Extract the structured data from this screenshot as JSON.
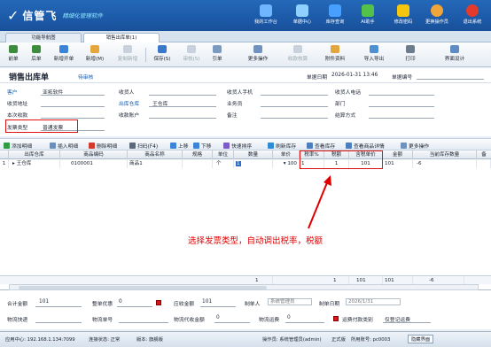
{
  "app": {
    "logo_text": "信管飞",
    "tagline": "精细化管理软件"
  },
  "top_nav": [
    {
      "label": "我的工作台",
      "icon": "monitor-icon"
    },
    {
      "label": "单据中心",
      "icon": "document-icon"
    },
    {
      "label": "库存查询",
      "icon": "warehouse-icon"
    },
    {
      "label": "AI助手",
      "icon": "ai-assistant-icon"
    },
    {
      "label": "修改密码",
      "icon": "lock-icon"
    },
    {
      "label": "更换操作员",
      "icon": "user-icon"
    },
    {
      "label": "退出系统",
      "icon": "exit-icon"
    }
  ],
  "tabs": [
    {
      "label": "功能导航图"
    },
    {
      "label": "销售出库单(1)"
    }
  ],
  "toolbar": [
    {
      "label": "前单",
      "icon": "arrow-left-icon"
    },
    {
      "label": "后单",
      "icon": "arrow-right-icon"
    },
    {
      "label": "新增开单",
      "icon": "new-icon"
    },
    {
      "label": "新增(M)",
      "icon": "add-icon"
    },
    {
      "label": "复制新增",
      "icon": "copy-icon"
    },
    {
      "label": "保存(S)",
      "icon": "save-icon"
    },
    {
      "label": "审核(S)",
      "icon": "audit-icon"
    },
    {
      "label": "引单",
      "icon": "import-order-icon"
    },
    {
      "label": "更多操作",
      "icon": "more-icon"
    },
    {
      "label": "收款核算",
      "icon": "payment-icon"
    },
    {
      "label": "附件资料",
      "icon": "attachment-icon"
    },
    {
      "label": "导入导出",
      "icon": "import-export-icon"
    },
    {
      "label": "打印",
      "icon": "print-icon"
    },
    {
      "label": "界面设计",
      "icon": "design-icon"
    }
  ],
  "doc": {
    "title": "销售出库单",
    "status": "待审核",
    "date_label": "单据日期",
    "date_value": "2026-01-31 13:46",
    "number_label": "单据编号",
    "number_value": ""
  },
  "form": {
    "customer_label": "客户",
    "customer_value": "亚拓软件",
    "shipper_label": "收货人",
    "shipper_value": "",
    "shipper_phone_label": "收货人手机",
    "shipper_phone_value": "",
    "contact_phone_label": "收货人电话",
    "contact_phone_value": "",
    "address_label": "收货地址",
    "address_value": "",
    "warehouse_label": "出库仓库",
    "warehouse_value": "王仓库",
    "salesman_label": "业务员",
    "salesman_value": "",
    "department_label": "部门",
    "department_value": "",
    "this_receipt_label": "本次收款",
    "this_receipt_value": "",
    "receipt_account_label": "收款账户",
    "receipt_account_value": "",
    "remark_label": "备注",
    "remark_value": "",
    "settlement_label": "结算方式",
    "settlement_value": "",
    "invoice_type_label": "发票类型",
    "invoice_type_value": "普通发票"
  },
  "grid_toolbar": [
    {
      "label": "添加明细",
      "icon": "add-row-icon"
    },
    {
      "label": "插入明细",
      "icon": "insert-row-icon"
    },
    {
      "label": "删除明细",
      "icon": "delete-row-icon"
    },
    {
      "label": "扫码(F4)",
      "icon": "scan-icon"
    },
    {
      "label": "上移",
      "icon": "move-up-icon"
    },
    {
      "label": "下移",
      "icon": "move-down-icon"
    },
    {
      "label": "快速排序",
      "icon": "sort-icon"
    },
    {
      "label": "刷新库存",
      "icon": "refresh-icon"
    },
    {
      "label": "查看库存",
      "icon": "view-stock-icon"
    },
    {
      "label": "查看商品详情",
      "icon": "product-detail-icon"
    },
    {
      "label": "更多操作",
      "icon": "more-ops-icon"
    }
  ],
  "grid": {
    "columns": [
      "",
      "出库仓库",
      "商品编码",
      "商品名称",
      "规格",
      "单位",
      "数量",
      "单价",
      "税率%",
      "税额",
      "含税单价",
      "金额",
      "当前库存数量",
      "备"
    ],
    "rows": [
      {
        "idx": "1",
        "warehouse": "王仓库",
        "code": "0100001",
        "name": "商品1",
        "spec": "",
        "unit": "个",
        "qty": "1",
        "price": "100",
        "tax_rate": "1",
        "tax": "1",
        "tax_price": "101",
        "amount": "101",
        "stock": "-6",
        "note": ""
      }
    ],
    "footer": {
      "qty": "1",
      "tax": "1",
      "tax_price": "101",
      "amount": "101",
      "stock": "-6"
    }
  },
  "annotation": "选择发票类型，自动调出税率，税额",
  "bottom": {
    "total_label": "合计金额",
    "total_value": "101",
    "discount_label": "整单优惠",
    "discount_value": "0",
    "receivable_label": "应收金额",
    "receivable_value": "101",
    "creator_label": "制单人",
    "creator_value": "系统管理员",
    "create_date_label": "制单日期",
    "create_date_value": "2026/1/31",
    "logistics_label": "物流快递",
    "logistics_value": "",
    "logistics_no_label": "物流单号",
    "logistics_no_value": "",
    "logistics_fee_label": "物流代收金额",
    "logistics_fee_value": "0",
    "freight_label": "物流运费",
    "freight_value": "0",
    "freight_type_label": "运费付款类别",
    "freight_type_value": "仅登记运费"
  },
  "statusbar": {
    "app_center": "应用中心: 192.168.1.134:7099",
    "link_status": "连接状态: 正常",
    "version": "版本: 旗舰版",
    "operator": "操作员: 系统管理员(admin)",
    "formal": "正式版",
    "account": "所用账号: pc0003",
    "minimize": "隐藏界面"
  }
}
